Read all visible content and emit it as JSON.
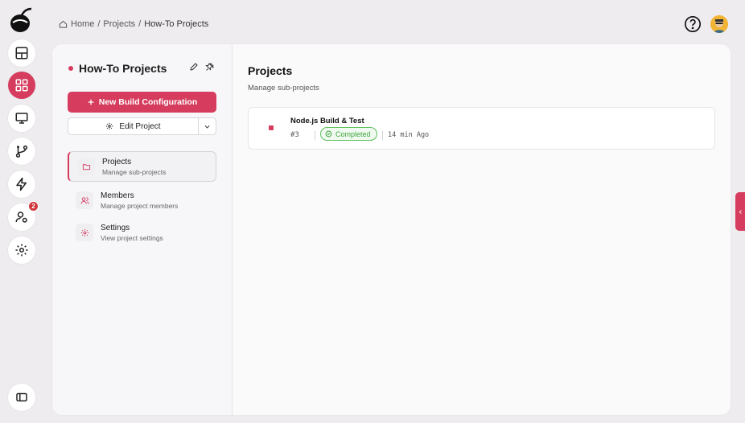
{
  "breadcrumb": {
    "home": "Home",
    "sep1": "/",
    "projects": "Projects",
    "sep2": "/",
    "current": "How-To Projects"
  },
  "rail": {
    "icons": [
      "logo-icon",
      "dashboard-icon",
      "grid-icon",
      "monitor-icon",
      "git-branch-icon",
      "lightning-icon",
      "user-settings-icon",
      "gear-icon",
      "sidebar-toggle-icon"
    ],
    "user_badge": "2"
  },
  "project": {
    "title": "How-To Projects",
    "new_build_label": "New Build Configuration",
    "edit_label": "Edit Project"
  },
  "nav": [
    {
      "title": "Projects",
      "subtitle": "Manage sub-projects"
    },
    {
      "title": "Members",
      "subtitle": "Manage project members"
    },
    {
      "title": "Settings",
      "subtitle": "View project settings"
    }
  ],
  "content": {
    "title": "Projects",
    "subtitle": "Manage sub-projects"
  },
  "builds": [
    {
      "name": "Node.js Build & Test",
      "number": "#3",
      "status": "Completed",
      "time": "14 min Ago"
    }
  ],
  "colors": {
    "accent": "#d63c5e",
    "status_success": "#3ea53e",
    "background": "#efecef"
  }
}
